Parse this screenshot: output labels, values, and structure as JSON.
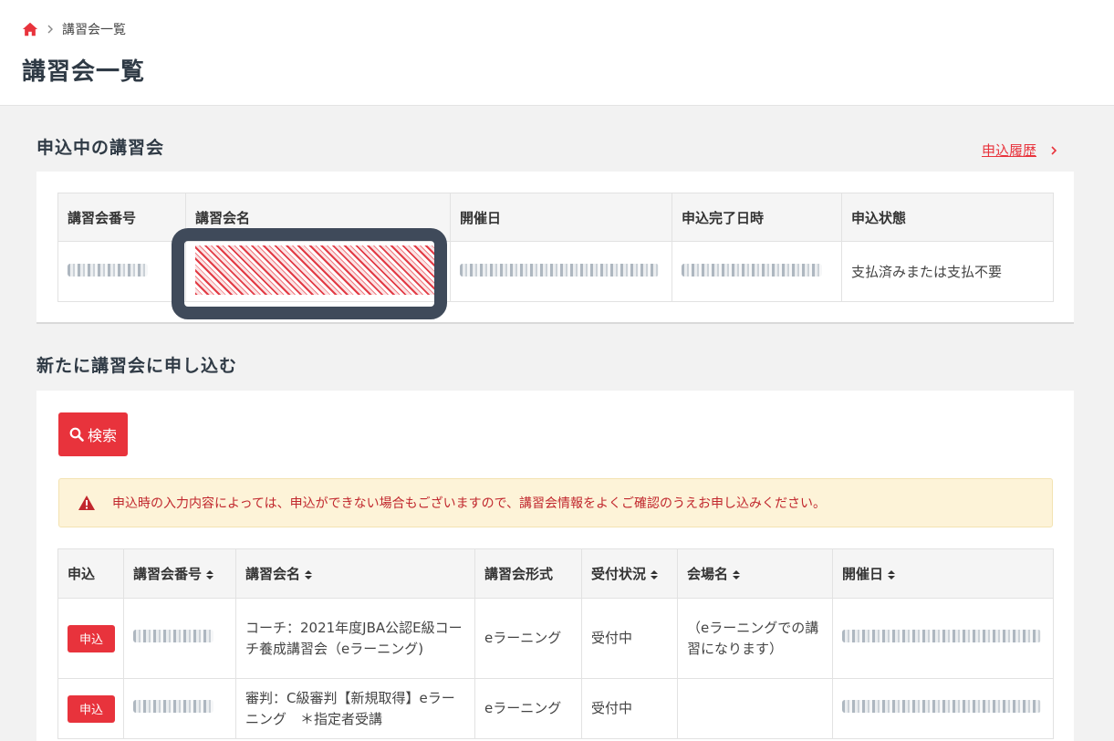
{
  "breadcrumb": {
    "current": "講習会一覧"
  },
  "page_title": "講習会一覧",
  "applying_section": {
    "title": "申込中の講習会",
    "history_link": "申込履歴",
    "columns": [
      "講習会番号",
      "講習会名",
      "開催日",
      "申込完了日時",
      "申込状態"
    ],
    "rows": [
      {
        "number": "",
        "name": "",
        "date": "",
        "completed_at": "",
        "status": "支払済みまたは支払不要"
      }
    ]
  },
  "new_section": {
    "title": "新たに講習会に申し込む",
    "search_label": "検索",
    "notice": "申込時の入力内容によっては、申込ができない場合もございますので、講習会情報をよくご確認のうえお申し込みください。",
    "columns": [
      "申込",
      "講習会番号",
      "講習会名",
      "講習会形式",
      "受付状況",
      "会場名",
      "開催日"
    ],
    "rows": [
      {
        "apply": "申込",
        "number": "",
        "name": "コーチ：2021年度JBA公認E級コーチ養成講習会（eラーニング)",
        "format": "eラーニング",
        "status": "受付中",
        "venue": "（eラーニングでの講習になります）",
        "date": ""
      },
      {
        "apply": "申込",
        "number": "",
        "name": "審判：C級審判【新規取得】eラーニング　＊指定者受講",
        "format": "eラーニング",
        "status": "受付中",
        "venue": "",
        "date": ""
      }
    ]
  },
  "colors": {
    "accent": "#e8333c",
    "title": "#2f3a45",
    "notice_bg": "#fdf3d8"
  }
}
